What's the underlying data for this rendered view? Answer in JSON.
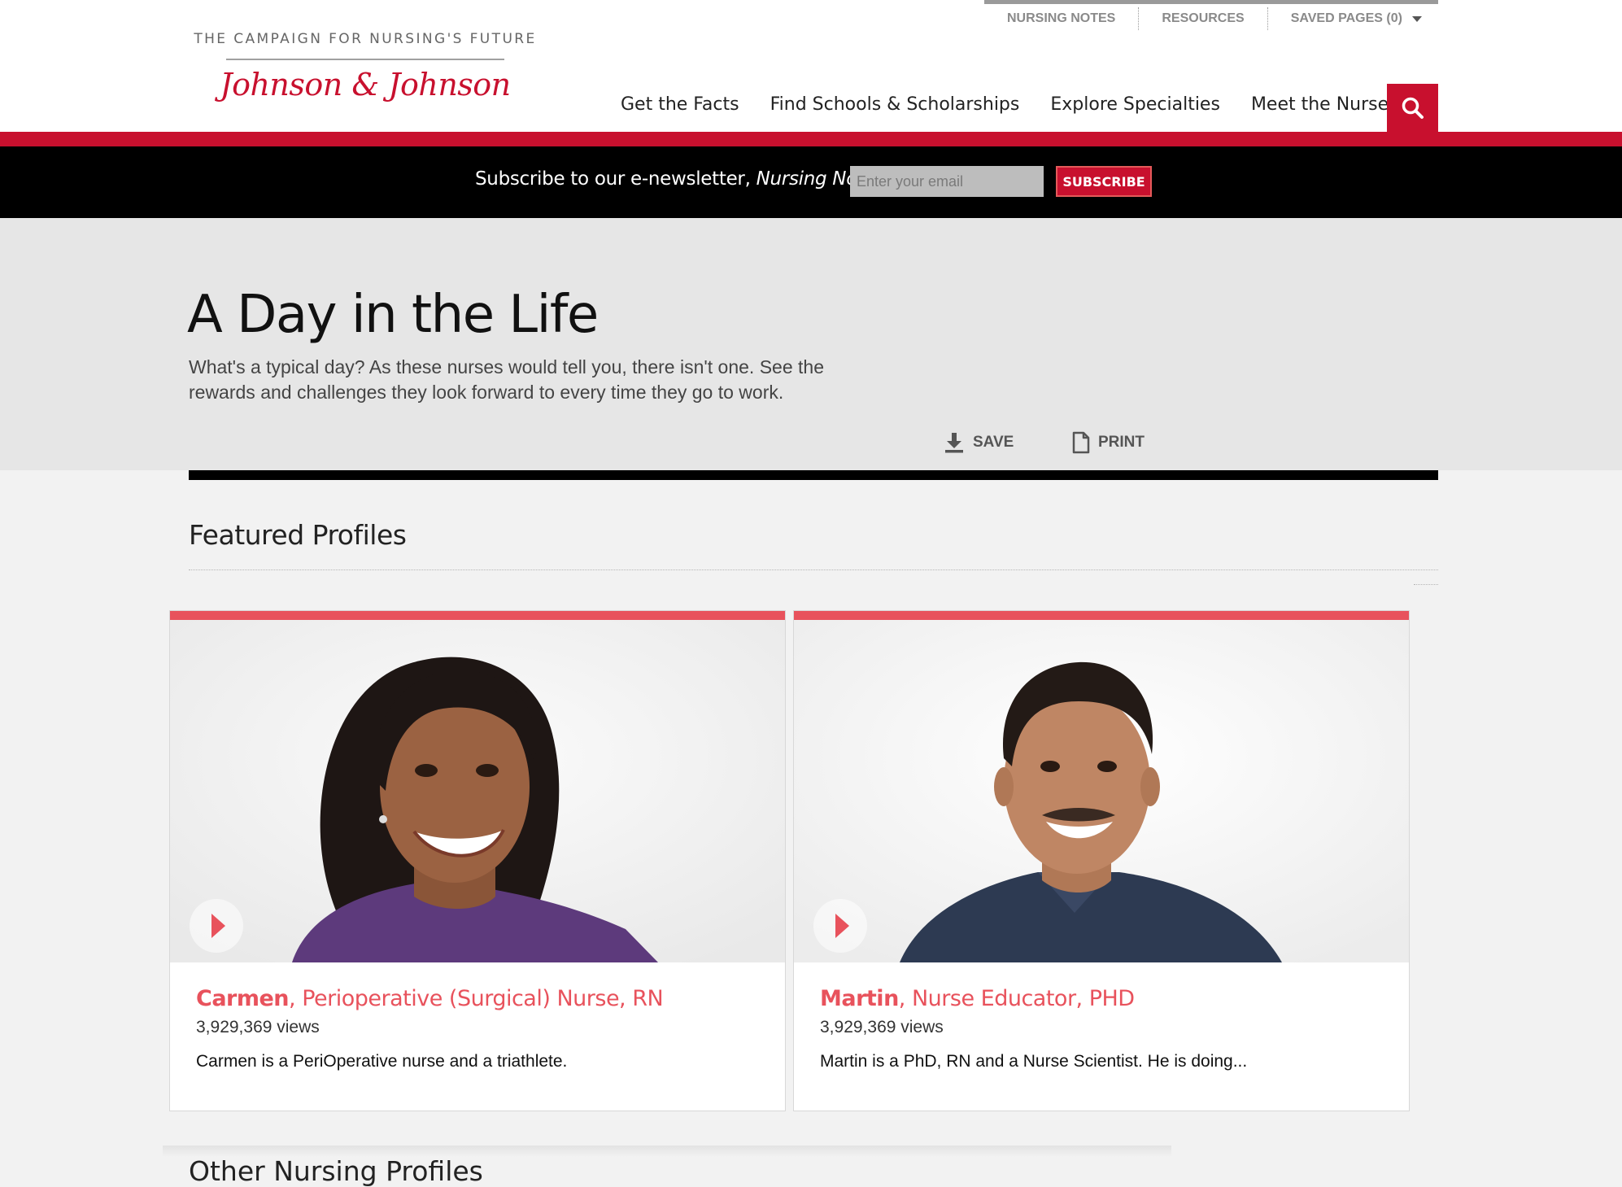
{
  "utility_nav": {
    "nursing_notes": "NURSING NOTES",
    "resources": "RESOURCES",
    "saved_pages": "SAVED PAGES (0)"
  },
  "logo": {
    "tagline": "THE CAMPAIGN FOR NURSING'S FUTURE",
    "brand": "Johnson & Johnson"
  },
  "main_nav": [
    {
      "label": "Get the Facts"
    },
    {
      "label": "Find Schools & Scholarships"
    },
    {
      "label": "Explore Specialties"
    },
    {
      "label": "Meet the Nurses"
    }
  ],
  "newsletter": {
    "text": "Subscribe to our e-newsletter, ",
    "name": "Nursing Notes",
    "placeholder": "Enter your email",
    "button": "SUBSCRIBE"
  },
  "hero": {
    "title": "A Day in the Life",
    "description": "What's a typical day? As these nurses would tell you, there isn't one. See the rewards and challenges they look forward to every time they go to work.",
    "save_label": "SAVE",
    "print_label": "PRINT"
  },
  "featured": {
    "title": "Featured Profiles",
    "cards": [
      {
        "name": "Carmen",
        "role": ", Perioperative (Surgical) Nurse, RN",
        "views": "3,929,369 views",
        "description": "Carmen is a PeriOperative nurse and a triathlete."
      },
      {
        "name": "Martin",
        "role": ", Nurse Educator, PHD",
        "views": "3,929,369 views",
        "description": "Martin is a PhD, RN and a Nurse Scientist. He is doing..."
      }
    ]
  },
  "other": {
    "title": "Other Nursing Profiles"
  },
  "colors": {
    "brand_red": "#c8102e",
    "accent_coral": "#e8525c"
  },
  "icons": [
    "search-icon",
    "download-icon",
    "document-icon",
    "play-icon",
    "chevron-down-icon"
  ]
}
